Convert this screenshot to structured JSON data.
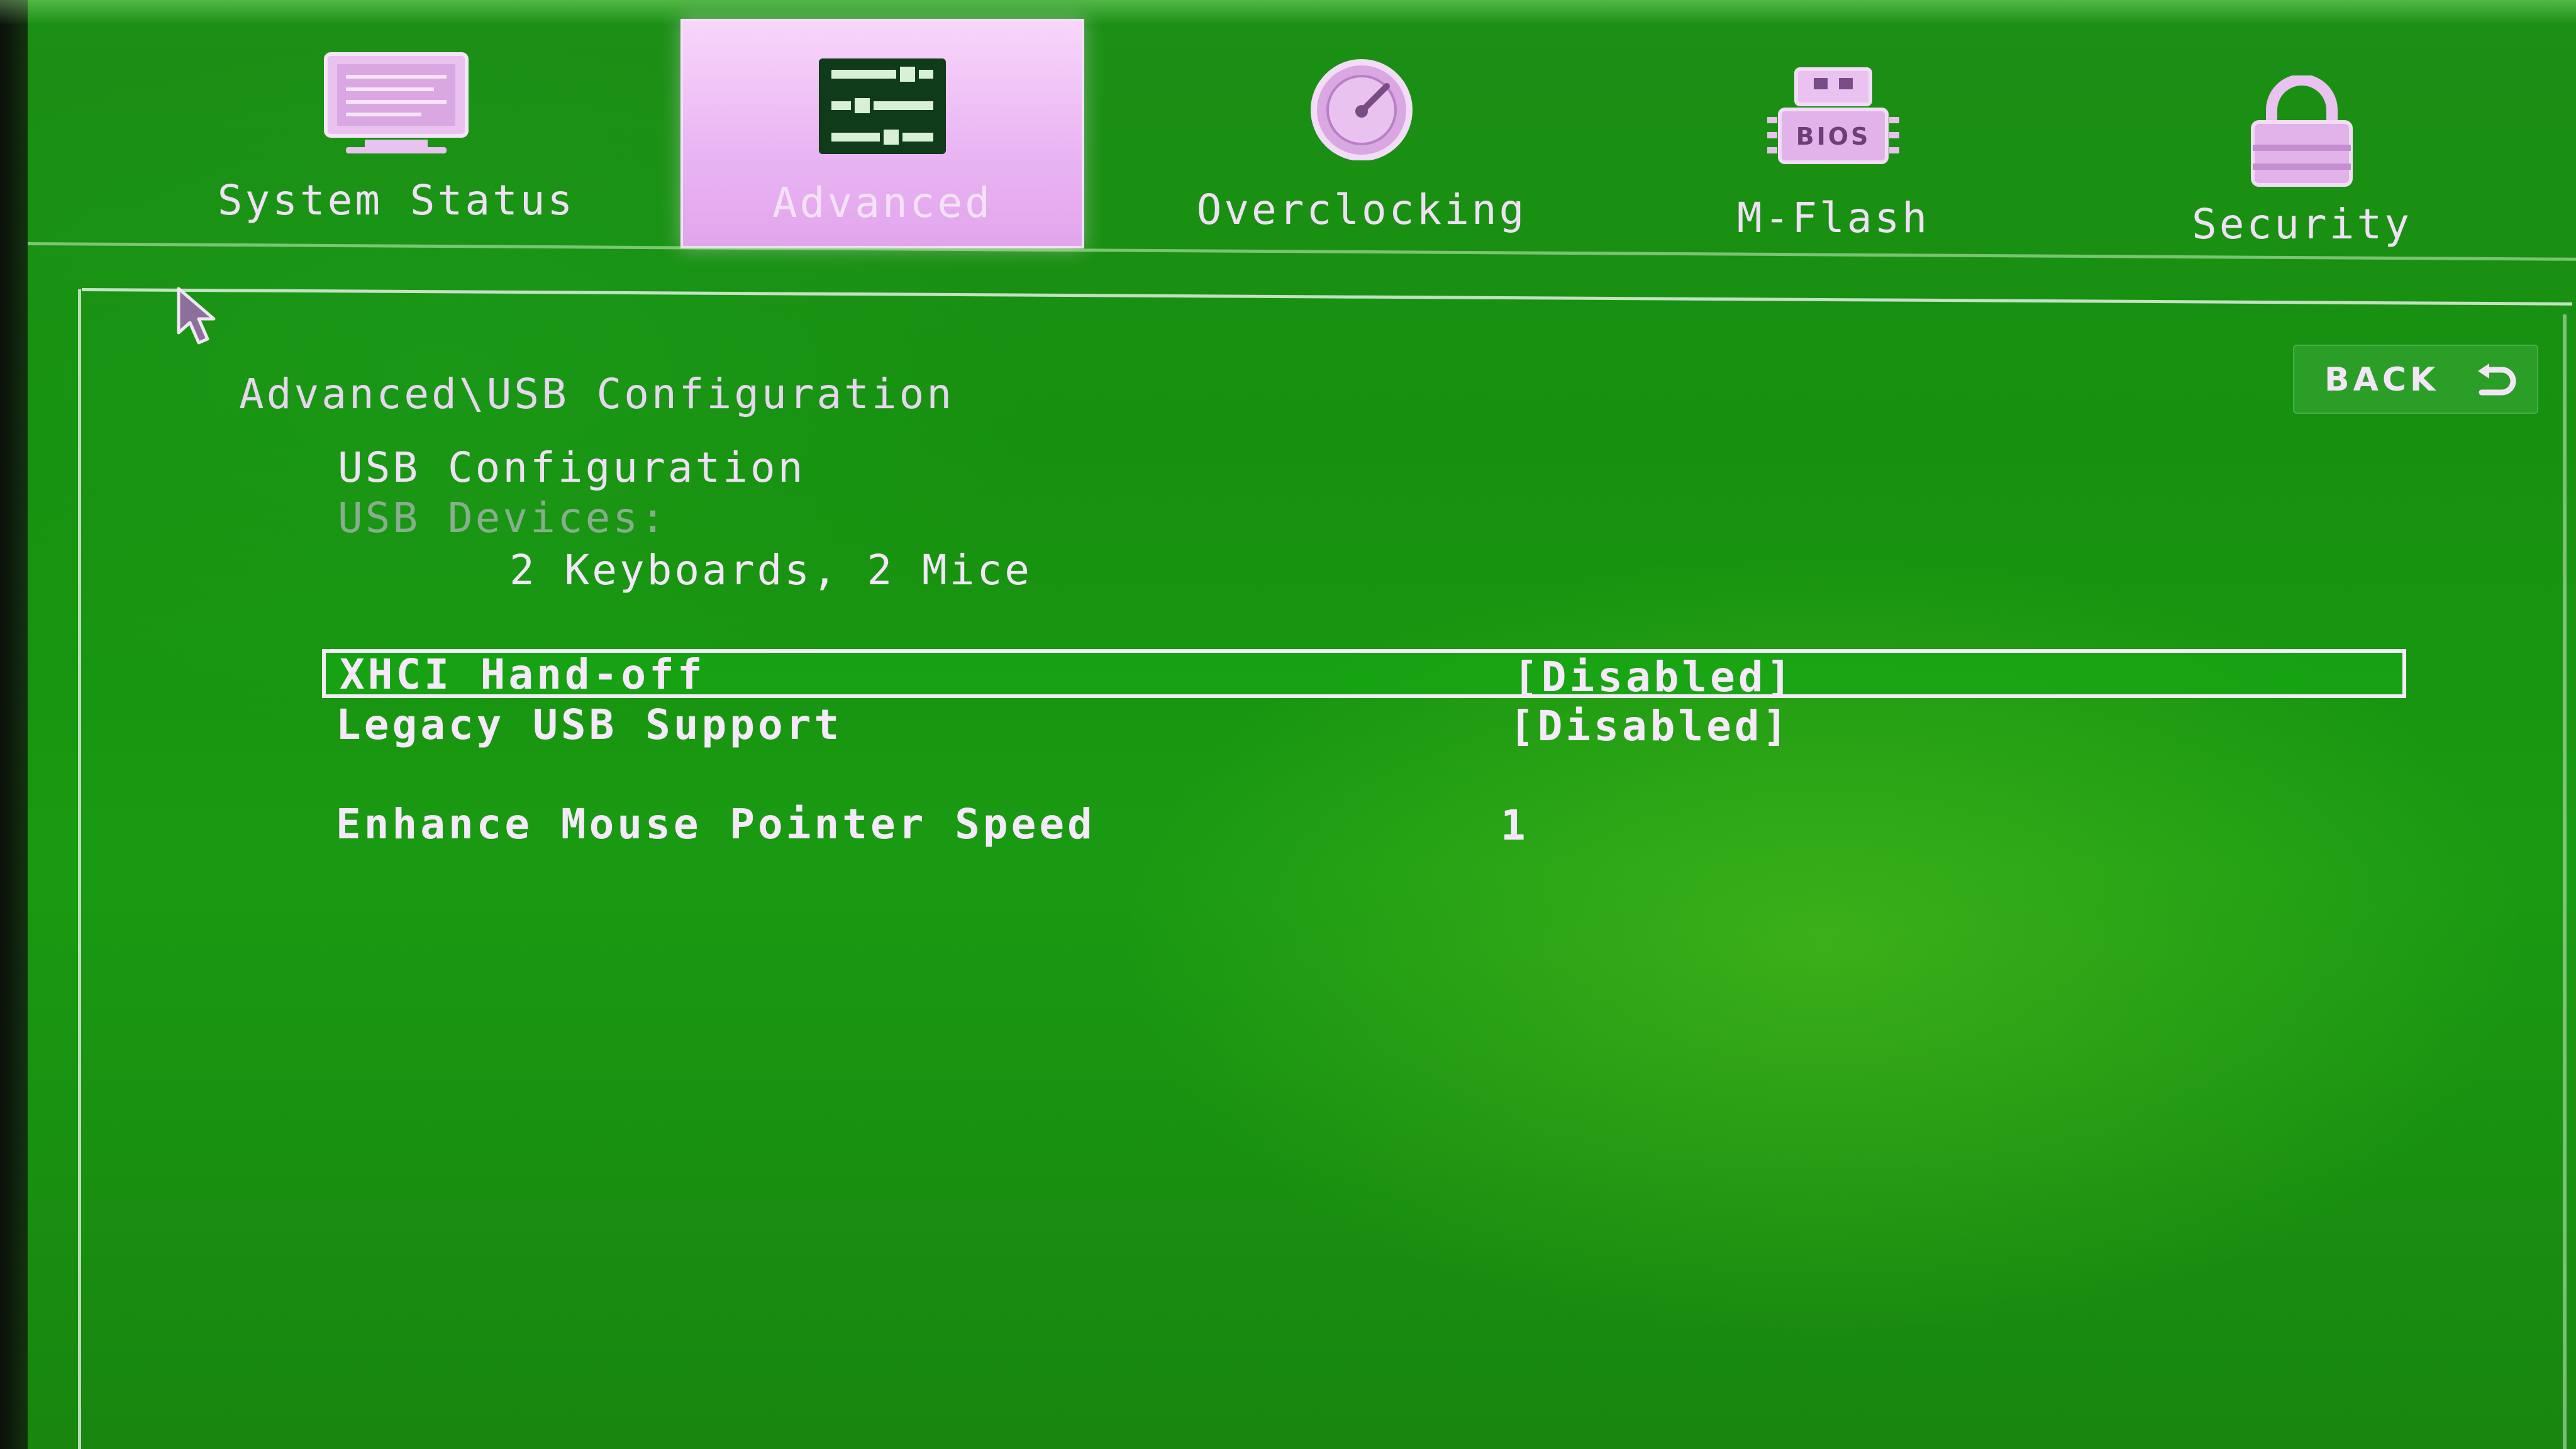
{
  "nav": {
    "tabs": [
      {
        "label": "System Status",
        "icon": "monitor-icon"
      },
      {
        "label": "Advanced",
        "icon": "sliders-icon",
        "selected": true
      },
      {
        "label": "Overclocking",
        "icon": "speedometer-icon"
      },
      {
        "label": "M-Flash",
        "icon": "bios-chip-icon",
        "icon_text": "BIOS"
      },
      {
        "label": "Security",
        "icon": "padlock-icon"
      }
    ]
  },
  "header": {
    "back_label": "BACK"
  },
  "page": {
    "breadcrumb": "Advanced\\USB Configuration",
    "section_title": "USB Configuration",
    "devices_label": "USB Devices:",
    "devices_value": "2 Keyboards, 2 Mice"
  },
  "settings": [
    {
      "name": "XHCI Hand-off",
      "value": "[Disabled]",
      "selected": true
    },
    {
      "name": "Legacy USB Support",
      "value": "[Disabled]"
    },
    {
      "name": "Enhance Mouse Pointer Speed",
      "value": "1"
    }
  ],
  "colors": {
    "background": "#1a9a12",
    "text": "#f1e4f6",
    "selected_tab": "#eab6f3",
    "highlight_border": "#f6ecf9"
  }
}
